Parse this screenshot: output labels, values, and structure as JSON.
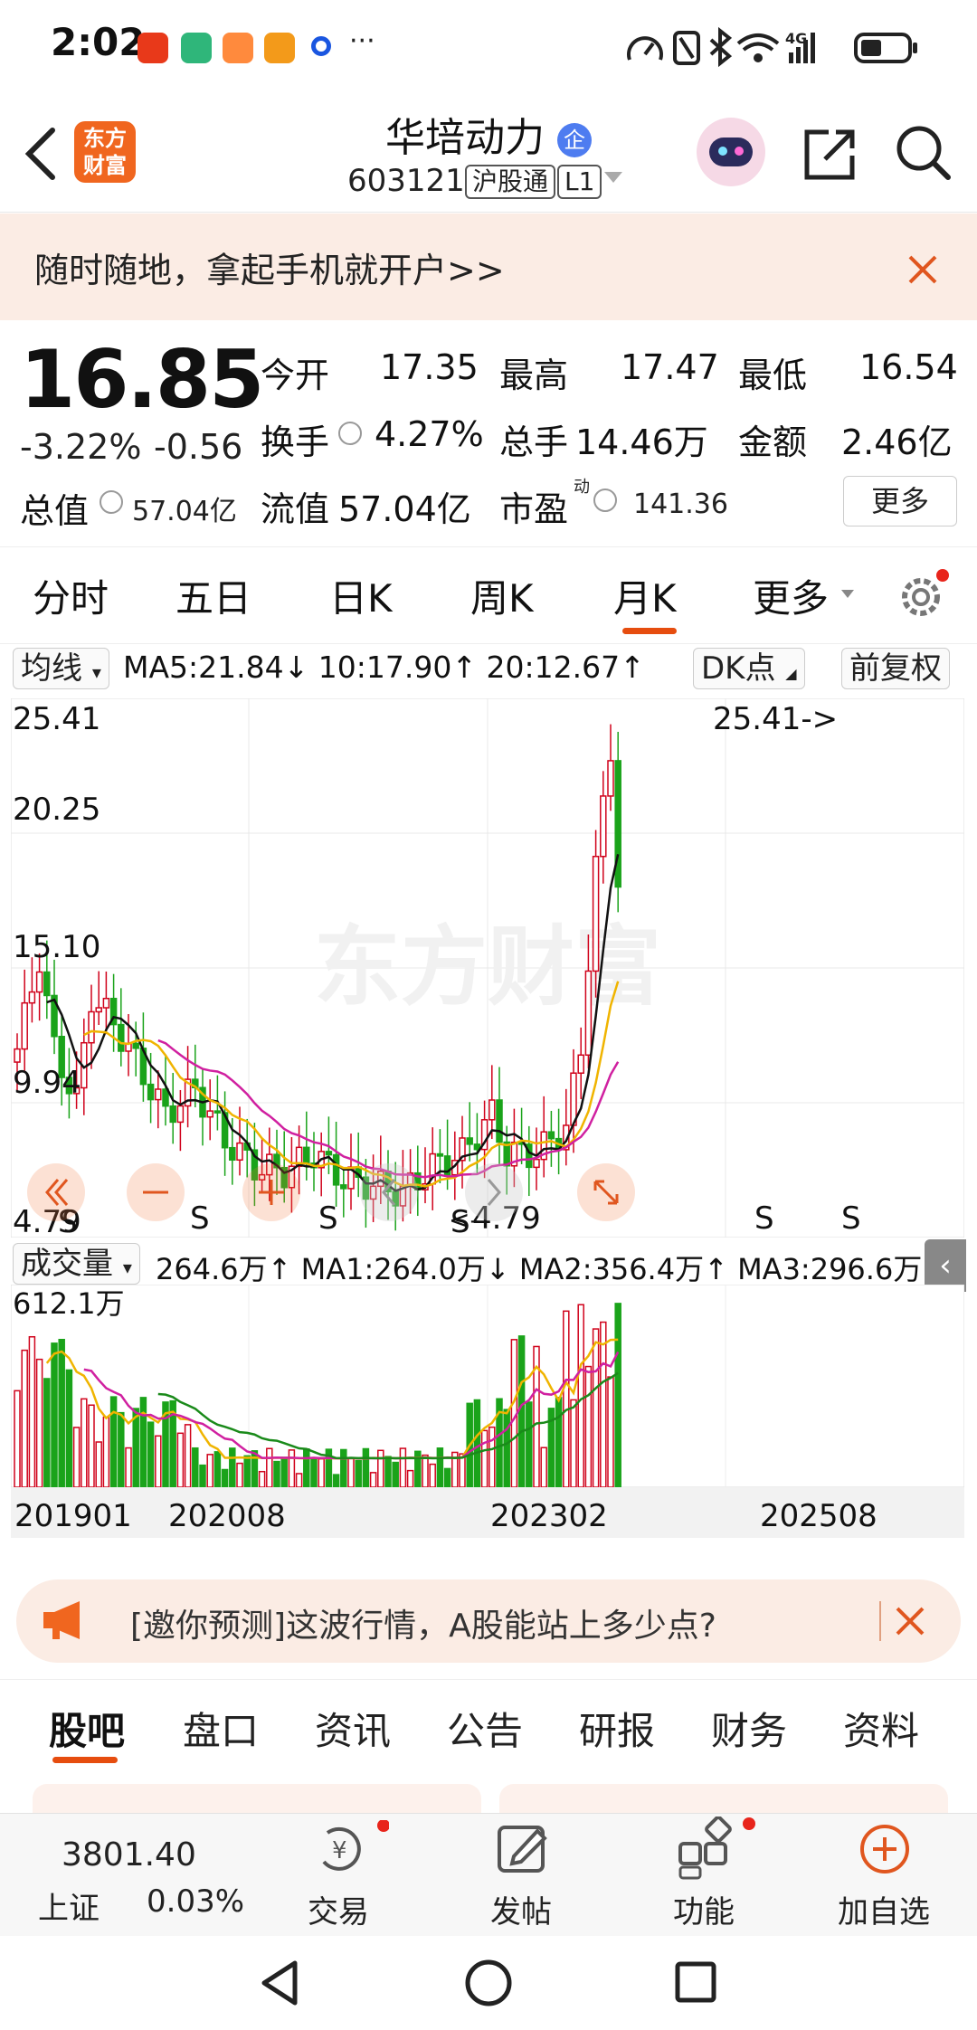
{
  "status": {
    "time": "2:02",
    "more": "···",
    "network": "4G"
  },
  "header": {
    "name": "华培动力",
    "badge": "企",
    "code": "603121",
    "tag1": "沪股通",
    "tag2": "L1",
    "logo_line1": "东方",
    "logo_line2": "财富"
  },
  "banner": {
    "text": "随时随地，拿起手机就开户>>"
  },
  "quote": {
    "price": "16.85",
    "change_pct": "-3.22%",
    "change": "-0.56",
    "open_label": "今开",
    "open": "17.35",
    "high_label": "最高",
    "high": "17.47",
    "low_label": "最低",
    "low": "16.54",
    "turnover_label": "换手",
    "turnover": "4.27%",
    "volume_label": "总手",
    "volume": "14.46万",
    "amount_label": "金额",
    "amount": "2.46亿",
    "mcap_label": "总值",
    "mcap": "57.04亿",
    "float_label": "流值",
    "float": "57.04亿",
    "pe_label": "市盈",
    "pe_sup": "动",
    "pe": "141.36",
    "more": "更多"
  },
  "period_tabs": [
    "分时",
    "五日",
    "日K",
    "周K",
    "月K",
    "更多"
  ],
  "ma": {
    "select": "均线",
    "text": "MA5:21.84↓ 10:17.90↑ 20:12.67↑",
    "dk": "DK点",
    "adjust": "前复权"
  },
  "kchart": {
    "y_labels": [
      "25.41",
      "20.25",
      "15.10",
      "9.94",
      "4.79"
    ],
    "max_note": "25.41->",
    "min_note": "4.79",
    "watermark": "东方财富",
    "s_marker": "S"
  },
  "volume": {
    "select": "成交量",
    "text": "264.6万↑ MA1:264.0万↓ MA2:356.4万↑ MA3:296.6万↓",
    "max_label": "612.1万"
  },
  "x_labels": [
    "201901",
    "202008",
    "202302",
    "202508"
  ],
  "colors": {
    "up": "#d0021b",
    "down": "#1aa31a",
    "ma5": "#111111",
    "ma10": "#f0b400",
    "ma20": "#d020a0",
    "accent": "#e64d0f"
  },
  "promo": {
    "text": "[邀你预测]这波行情，A股能站上多少点?"
  },
  "info_tabs": [
    "股吧",
    "盘口",
    "资讯",
    "公告",
    "研报",
    "财务",
    "资料"
  ],
  "bottom": {
    "index_value": "3801.40",
    "index_name": "上证",
    "index_pct": "0.03%",
    "trade": "交易",
    "post": "发帖",
    "func": "功能",
    "add": "加自选"
  }
}
